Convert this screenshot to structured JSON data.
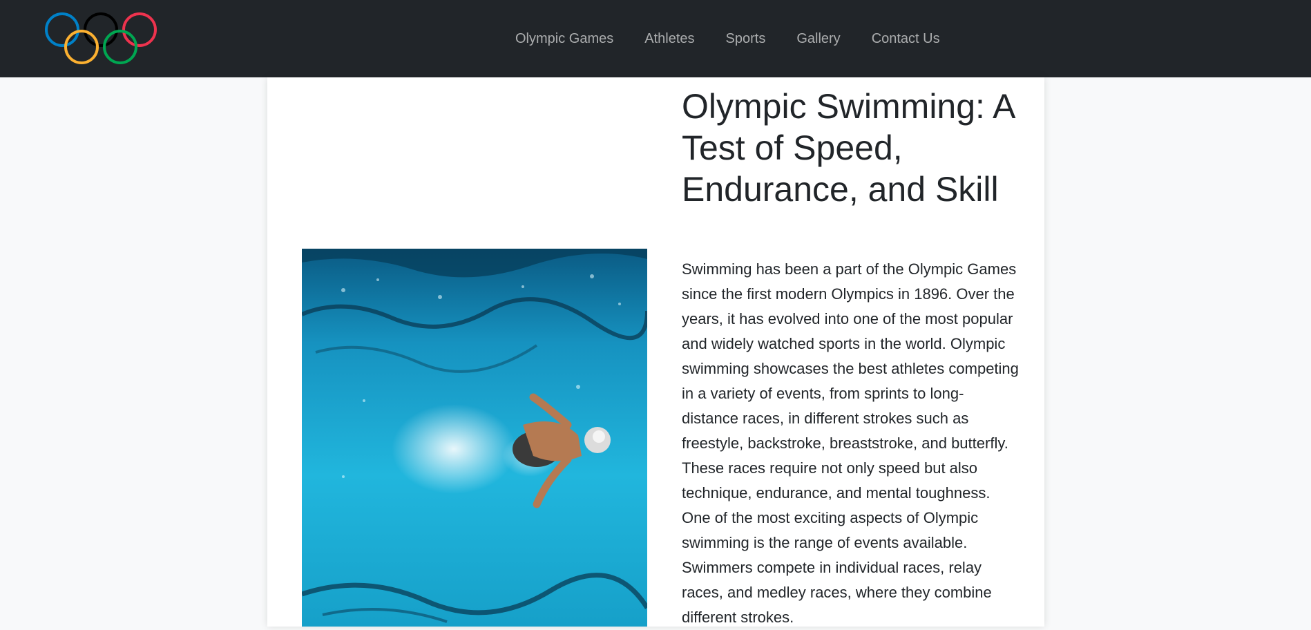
{
  "nav": {
    "logo_alt": "Olympic rings",
    "links": [
      "Olympic Games",
      "Athletes",
      "Sports",
      "Gallery",
      "Contact Us"
    ]
  },
  "article": {
    "title": "Olympic Swimming: A Test of Speed, Endurance, and Skill",
    "body": "Swimming has been a part of the Olympic Games since the first modern Olympics in 1896. Over the years, it has evolved into one of the most popular and widely watched sports in the world. Olympic swimming showcases the best athletes competing in a variety of events, from sprints to long-distance races, in different strokes such as freestyle, backstroke, breaststroke, and butterfly. These races require not only speed but also technique, endurance, and mental toughness. One of the most exciting aspects of Olympic swimming is the range of events available. Swimmers compete in individual races, relay races, and medley races, where they combine different strokes.",
    "image_subject": "swimmer-butterfly-stroke-photo"
  },
  "colors": {
    "navbar_bg": "#212529",
    "page_bg": "#f8f9fa",
    "ring_blue": "#0081c8",
    "ring_black": "#000000",
    "ring_red": "#ee334e",
    "ring_yellow": "#fcb131",
    "ring_green": "#00a651"
  }
}
